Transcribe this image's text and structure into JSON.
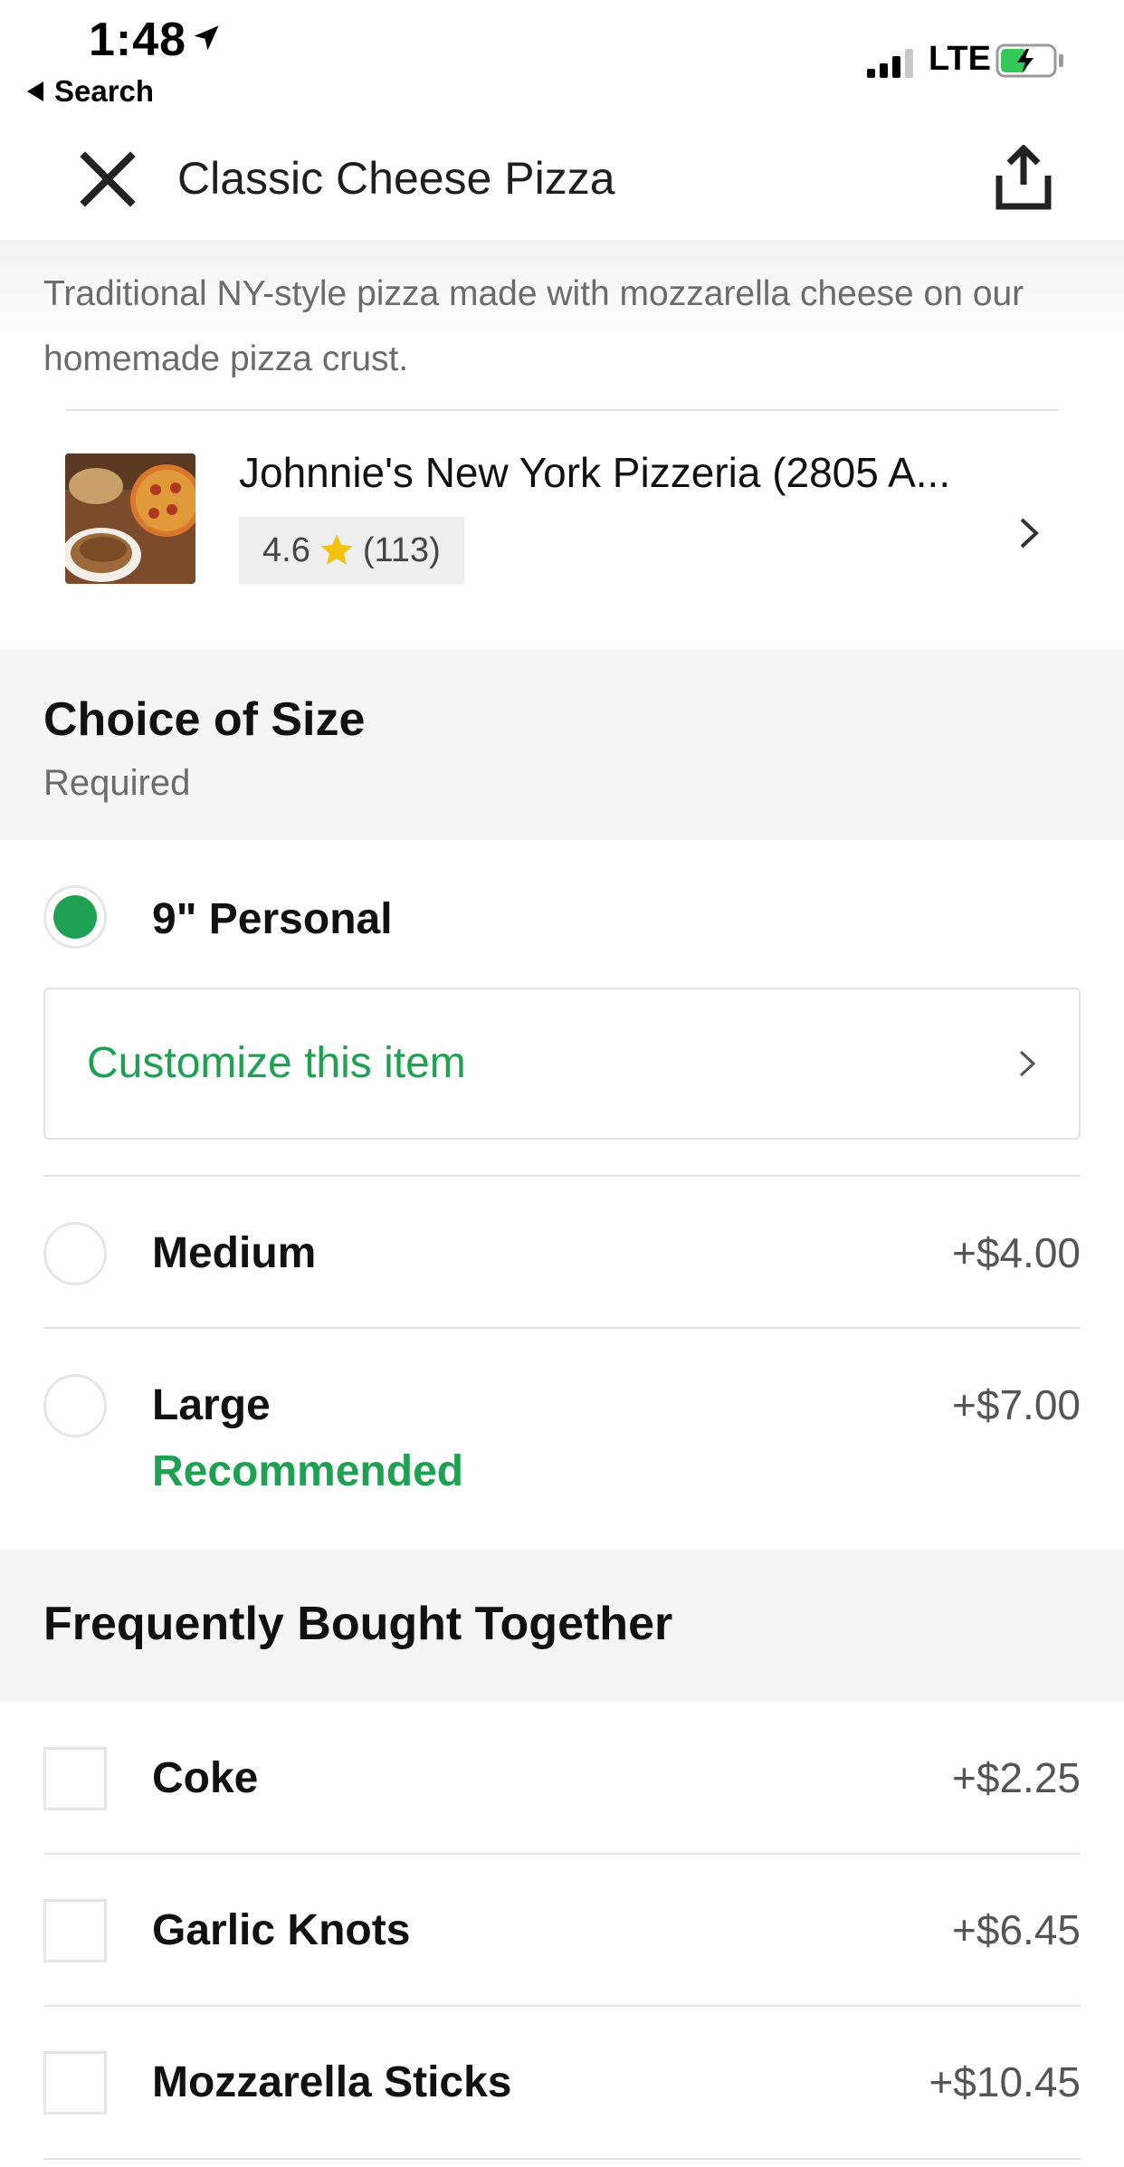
{
  "status_bar": {
    "time": "1:48",
    "back_label": "Search",
    "network": "LTE"
  },
  "header": {
    "title": "Classic Cheese Pizza"
  },
  "item": {
    "description": "Traditional NY-style pizza made with mozzarella cheese on our homemade pizza crust."
  },
  "restaurant": {
    "name": "Johnnie's New York Pizzeria (2805 A...",
    "rating": "4.6",
    "review_count": "(113)"
  },
  "size_section": {
    "title": "Choice of Size",
    "subtitle": "Required",
    "options": [
      {
        "label": "9\" Personal",
        "price": "",
        "selected": true
      },
      {
        "label": "Medium",
        "price": "+$4.00",
        "selected": false
      },
      {
        "label": "Large",
        "price": "+$7.00",
        "selected": false,
        "tag": "Recommended"
      }
    ],
    "customize_label": "Customize this item"
  },
  "together_section": {
    "title": "Frequently Bought Together",
    "items": [
      {
        "label": "Coke",
        "price": "+$2.25",
        "checked": false
      },
      {
        "label": "Garlic Knots",
        "price": "+$6.45",
        "checked": false
      },
      {
        "label": "Mozzarella Sticks",
        "price": "+$10.45",
        "checked": false
      }
    ]
  },
  "colors": {
    "accent_green": "#1ea152",
    "star_yellow": "#f6c20f",
    "section_background": "#f5f5f5"
  },
  "icons": [
    "location-arrow-icon",
    "back-triangle-icon",
    "signal-icon",
    "battery-charging-icon",
    "close-icon",
    "share-icon",
    "star-icon",
    "chevron-right-icon"
  ]
}
